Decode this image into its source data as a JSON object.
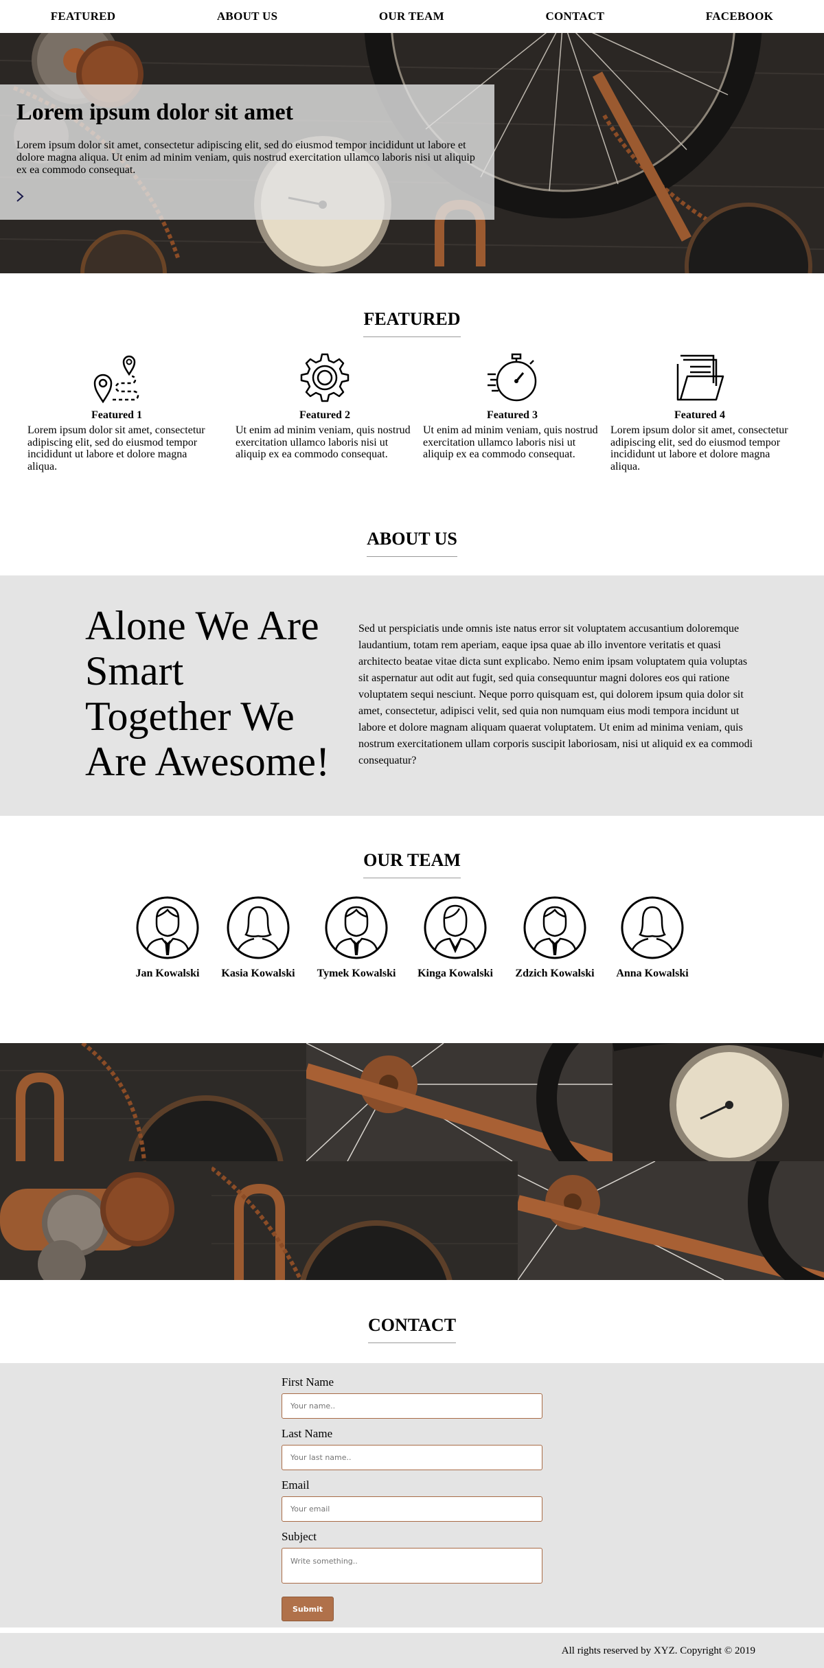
{
  "nav": {
    "items": [
      "FEATURED",
      "ABOUT US",
      "OUR TEAM",
      "CONTACT",
      "FACEBOOK"
    ]
  },
  "hero": {
    "title": "Lorem ipsum dolor sit amet",
    "text": "Lorem ipsum dolor sit amet, consectetur adipiscing elit, sed do eiusmod tempor incididunt ut labore et dolore magna aliqua. Ut enim ad minim veniam, quis nostrud exercitation ullamco laboris nisi ut aliquip ex ea commodo consequat.",
    "arrow_icon": "chevron-right-icon"
  },
  "featured": {
    "title": "FEATURED",
    "items": [
      {
        "icon": "map-route-icon",
        "title": "Featured 1",
        "text": "Lorem ipsum dolor sit amet, consectetur adipiscing elit, sed do eiusmod tempor incididunt ut labore et dolore magna aliqua."
      },
      {
        "icon": "gear-icon",
        "title": "Featured 2",
        "text": "Ut enim ad minim veniam, quis nostrud exercitation ullamco laboris nisi ut aliquip ex ea commodo consequat."
      },
      {
        "icon": "stopwatch-icon",
        "title": "Featured 3",
        "text": "Ut enim ad minim veniam, quis nostrud exercitation ullamco laboris nisi ut aliquip ex ea commodo consequat."
      },
      {
        "icon": "folder-icon",
        "title": "Featured 4",
        "text": "Lorem ipsum dolor sit amet, consectetur adipiscing elit, sed do eiusmod tempor incididunt ut labore et dolore magna aliqua."
      }
    ]
  },
  "about": {
    "title": "ABOUT US",
    "quote": "Alone We Are Smart Together We Are Awesome!",
    "text": "Sed ut perspiciatis unde omnis iste natus error sit voluptatem accusantium doloremque laudantium, totam rem aperiam, eaque ipsa quae ab illo inventore veritatis et quasi architecto beatae vitae dicta sunt explicabo. Nemo enim ipsam voluptatem quia voluptas sit aspernatur aut odit aut fugit, sed quia consequuntur magni dolores eos qui ratione voluptatem sequi nesciunt. Neque porro quisquam est, qui dolorem ipsum quia dolor sit amet, consectetur, adipisci velit, sed quia non numquam eius modi tempora incidunt ut labore et dolore magnam aliquam quaerat voluptatem. Ut enim ad minima veniam, quis nostrum exercitationem ullam corporis suscipit laboriosam, nisi ut aliquid ex ea commodi consequatur?"
  },
  "team": {
    "title": "OUR TEAM",
    "members": [
      {
        "name": "Jan Kowalski",
        "avatar": "male-avatar-icon"
      },
      {
        "name": "Kasia Kowalski",
        "avatar": "female-avatar-icon"
      },
      {
        "name": "Tymek Kowalski",
        "avatar": "male-avatar-icon"
      },
      {
        "name": "Kinga Kowalski",
        "avatar": "female-suit-avatar-icon"
      },
      {
        "name": "Zdzich Kowalski",
        "avatar": "male-avatar-icon"
      },
      {
        "name": "Anna Kowalski",
        "avatar": "female-avatar-icon"
      }
    ]
  },
  "contact": {
    "title": "CONTACT",
    "first_name_label": "First Name",
    "first_name_placeholder": "Your name..",
    "last_name_label": "Last Name",
    "last_name_placeholder": "Your last name..",
    "email_label": "Email",
    "email_placeholder": "Your email",
    "subject_label": "Subject",
    "subject_placeholder": "Write something..",
    "submit_label": "Submit"
  },
  "footer": {
    "text": "All rights reserved by XYZ. Copyright © 2019"
  },
  "colors": {
    "accent": "#b0714a",
    "band": "#e4e4e4",
    "rust": "#a2592e"
  }
}
